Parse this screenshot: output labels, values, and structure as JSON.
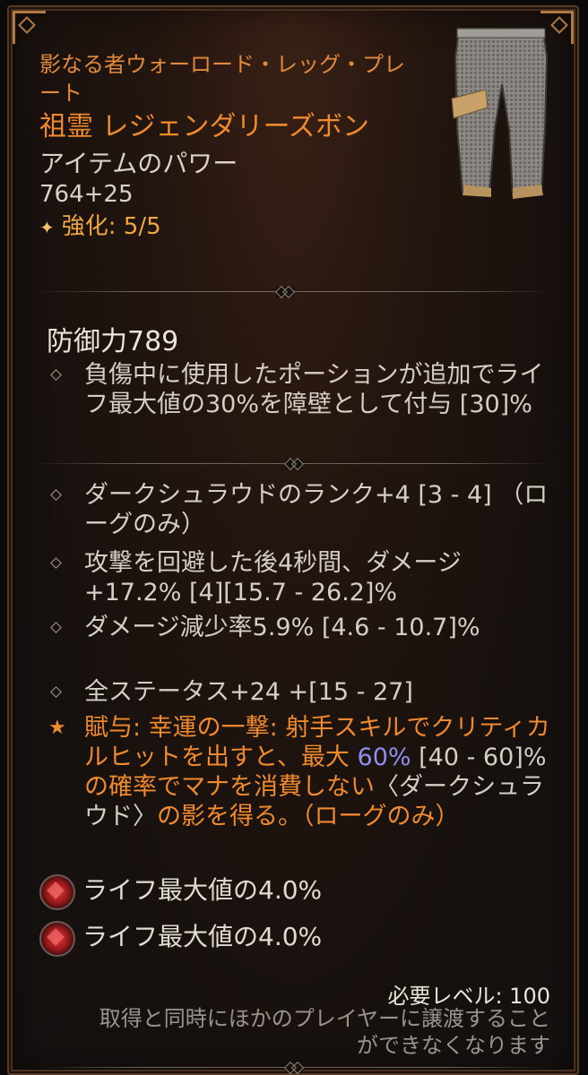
{
  "item": {
    "name": "影なる者ウォーロード・レッグ・プレート",
    "rarity_type": "祖霊 レジェンダリーズボン",
    "power_label": "アイテムのパワー",
    "power_value": "764+25",
    "upgrade": "強化: 5/5",
    "thumbnail_icon": "leg-plate-icon"
  },
  "armor": "防御力789",
  "implicit": "負傷中に使用したポーションが追加でライフ最大値の30%を障壁として付与 [30]%",
  "affixes": [
    "ダークシュラウドのランク+4 [3 - 4] （ローグのみ）",
    "攻撃を回避した後4秒間、ダメージ+17.2% [4][15.7 - 26.2]%",
    "ダメージ減少率5.9% [4.6 - 10.7]%",
    "全ステータス+24 +[15 - 27]"
  ],
  "legendary": {
    "prefix": "賦与: 幸運の一撃: 射手",
    "text1": "スキルでクリティカルヒットを出すと、最大",
    "value": "60%",
    "range": "[40 - 60]%",
    "text2": "の確率でマナを消費しない",
    "skill": "〈ダークシュラウド〉",
    "text3": "の影を得る。（ローグのみ）"
  },
  "sockets": [
    {
      "gem_icon": "ruby-gem-icon",
      "text": "ライフ最大値の4.0%"
    },
    {
      "gem_icon": "ruby-gem-icon",
      "text": "ライフ最大値の4.0%"
    }
  ],
  "footer": {
    "required_level": "必要レベル: 100",
    "account_bound": "取得と同時にほかのプレイヤーに譲渡することができなくなります"
  },
  "colors": {
    "legendary_orange": "#f08a2e",
    "value_blue": "#8f8ff0",
    "frame_bronze": "#b07a43"
  }
}
